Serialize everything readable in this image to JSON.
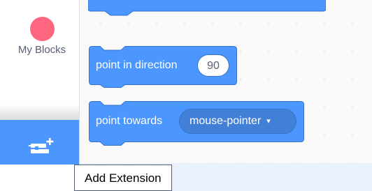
{
  "sidebar": {
    "category": {
      "label": "My Blocks",
      "color": "#ff6680"
    },
    "add_extension": {
      "icon": "add-extension-icon",
      "color": "#4c97ff"
    }
  },
  "blocks": {
    "color": "#4c97ff",
    "border_color": "#3373cc",
    "point_in_direction": {
      "label": "point in direction",
      "value": "90"
    },
    "point_towards": {
      "label": "point towards",
      "value": "mouse-pointer",
      "caret": "▾"
    }
  },
  "tooltip": {
    "text": "Add Extension"
  }
}
